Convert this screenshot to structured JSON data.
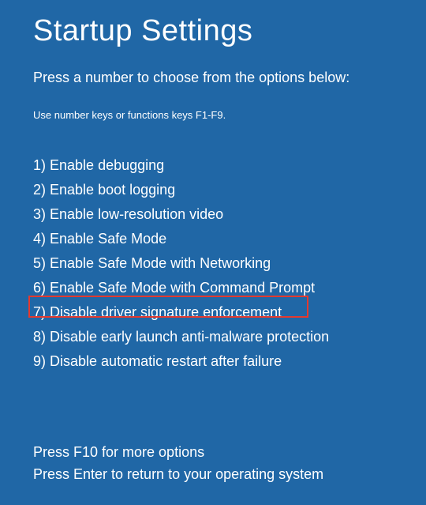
{
  "title": "Startup Settings",
  "instruction": "Press a number to choose from the options below:",
  "hint": "Use number keys or functions keys F1-F9.",
  "options": [
    {
      "num": "1",
      "label": "Enable debugging"
    },
    {
      "num": "2",
      "label": "Enable boot logging"
    },
    {
      "num": "3",
      "label": "Enable low-resolution video"
    },
    {
      "num": "4",
      "label": "Enable Safe Mode"
    },
    {
      "num": "5",
      "label": "Enable Safe Mode with Networking"
    },
    {
      "num": "6",
      "label": "Enable Safe Mode with Command Prompt"
    },
    {
      "num": "7",
      "label": "Disable driver signature enforcement"
    },
    {
      "num": "8",
      "label": "Disable early launch anti-malware protection"
    },
    {
      "num": "9",
      "label": "Disable automatic restart after failure"
    }
  ],
  "highlighted_index": 6,
  "footer": {
    "more_options": "Press F10 for more options",
    "return_os": "Press Enter to return to your operating system"
  }
}
